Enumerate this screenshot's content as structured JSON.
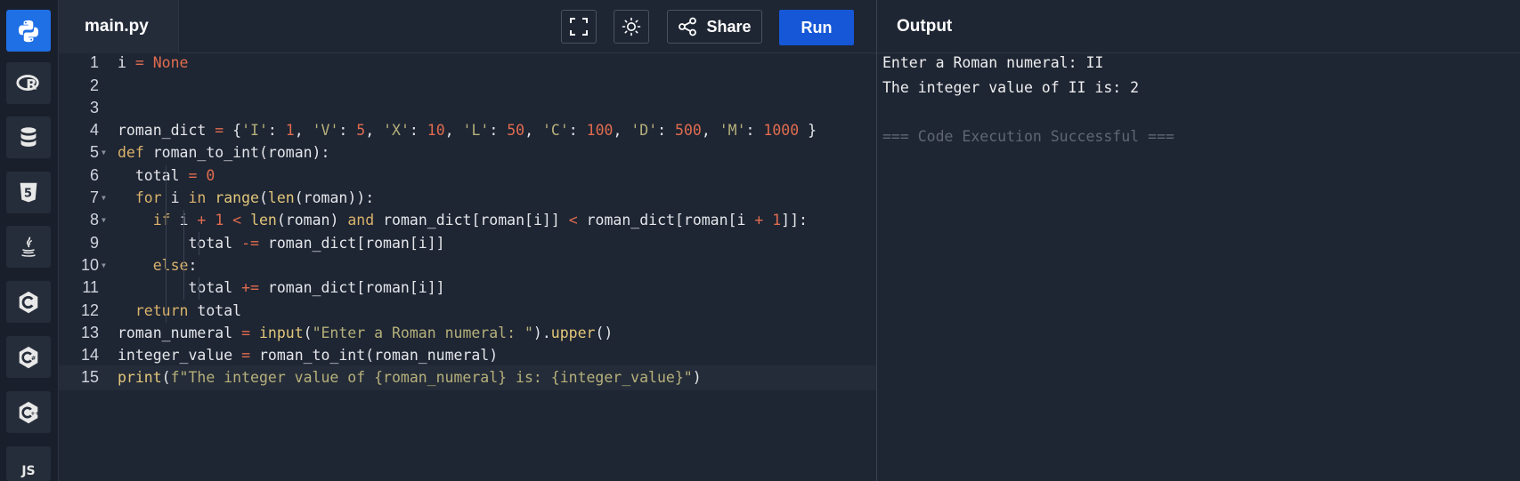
{
  "sidebar": {
    "items": [
      {
        "name": "python",
        "icon": "python-icon",
        "active": true
      },
      {
        "name": "r",
        "icon": "r-icon",
        "active": false
      },
      {
        "name": "sql",
        "icon": "database-icon",
        "active": false
      },
      {
        "name": "html",
        "icon": "html5-icon",
        "active": false
      },
      {
        "name": "java",
        "icon": "java-icon",
        "active": false
      },
      {
        "name": "c",
        "icon": "c-icon",
        "active": false
      },
      {
        "name": "csharp",
        "icon": "csharp-icon",
        "active": false
      },
      {
        "name": "cpp",
        "icon": "cpp-icon",
        "active": false
      },
      {
        "name": "javascript",
        "icon": "js-icon",
        "label": "JS",
        "active": false
      }
    ]
  },
  "toolbar": {
    "file_tab": "main.py",
    "fullscreen_icon": "fullscreen-icon",
    "theme_icon": "sun-icon",
    "share_label": "Share",
    "run_label": "Run"
  },
  "editor": {
    "lines": [
      "i = None",
      "",
      "",
      "roman_dict = {'I': 1, 'V': 5, 'X': 10, 'L': 50, 'C': 100, 'D': 500, 'M': 1000 }",
      "def roman_to_int(roman):",
      "  total = 0",
      "  for i in range(len(roman)):",
      "    if i + 1 < len(roman) and roman_dict[roman[i]] < roman_dict[roman[i + 1]]:",
      "        total -= roman_dict[roman[i]]",
      "    else:",
      "        total += roman_dict[roman[i]]",
      "  return total",
      "roman_numeral = input(\"Enter a Roman numeral: \").upper()",
      "integer_value = roman_to_int(roman_numeral)",
      "print(f\"The integer value of {roman_numeral} is: {integer_value}\")"
    ],
    "line_numbers": [
      "1",
      "2",
      "3",
      "4",
      "5",
      "6",
      "7",
      "8",
      "9",
      "10",
      "11",
      "12",
      "13",
      "14",
      "15"
    ],
    "folded_lines": [
      5,
      7,
      8,
      10
    ],
    "current_line": 15
  },
  "output": {
    "title": "Output",
    "lines": [
      "Enter a Roman numeral: II",
      "The integer value of II is: 2",
      "",
      "=== Code Execution Successful ==="
    ]
  },
  "colors": {
    "accent": "#1557d6",
    "active_sidebar": "#1f6fe5",
    "keyword": "#d9b36b",
    "number": "#e06c4f",
    "string": "#b5b07a"
  }
}
